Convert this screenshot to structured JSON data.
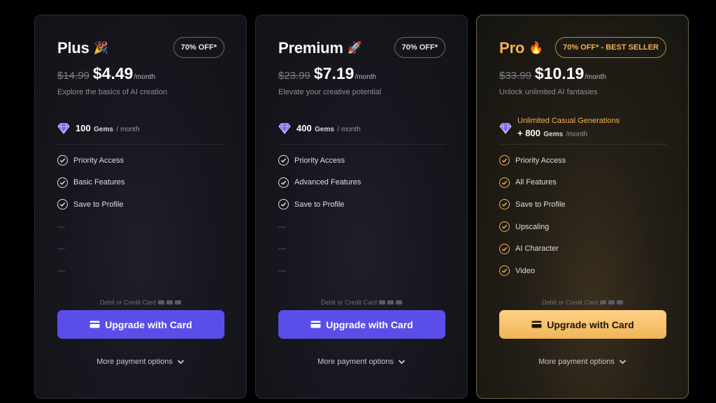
{
  "plans": [
    {
      "name": "Plus",
      "emoji": "🎉",
      "badge": "70% OFF*",
      "old_price": "$14.99",
      "price": "$4.49",
      "per": "/month",
      "tagline": "Explore the basics of AI creation",
      "gems_amount": "100",
      "gems_unit": "Gems",
      "gems_period": "/ month",
      "features": [
        "Priority Access",
        "Basic Features",
        "Save to Profile",
        "—",
        "—",
        "—"
      ],
      "pay_hint": "Debit or Credit Card",
      "button": "Upgrade with Card",
      "more": "More payment options"
    },
    {
      "name": "Premium",
      "emoji": "🚀",
      "badge": "70% OFF*",
      "old_price": "$23.99",
      "price": "$7.19",
      "per": "/month",
      "tagline": "Elevate your creative potential",
      "gems_amount": "400",
      "gems_unit": "Gems",
      "gems_period": "/ month",
      "features": [
        "Priority Access",
        "Advanced Features",
        "Save to Profile",
        "—",
        "—",
        "—"
      ],
      "pay_hint": "Debit or Credit Card",
      "button": "Upgrade with Card",
      "more": "More payment options"
    },
    {
      "name": "Pro",
      "emoji": "🔥",
      "badge": "70% OFF* - BEST SELLER",
      "old_price": "$33.99",
      "price": "$10.19",
      "per": "/month",
      "tagline": "Unlock unlimited AI fantasies",
      "gems_unlimited": "Unlimited Casual Generations",
      "gems_amount": "+ 800",
      "gems_unit": "Gems",
      "gems_period": "/month",
      "features": [
        "Priority Access",
        "All Features",
        "Save to Profile",
        "Upscaling",
        "AI Character",
        "Video"
      ],
      "pay_hint": "Debit or Credit Card",
      "button": "Upgrade with Card",
      "more": "More payment options"
    }
  ],
  "colors": {
    "accent_purple": "#5b4ee8",
    "accent_gold": "#f3b24f",
    "background": "#000000"
  },
  "icons": {
    "gem": "gem-icon",
    "check": "check-circle-icon",
    "card": "credit-card-icon",
    "chevron": "chevron-down-icon"
  }
}
